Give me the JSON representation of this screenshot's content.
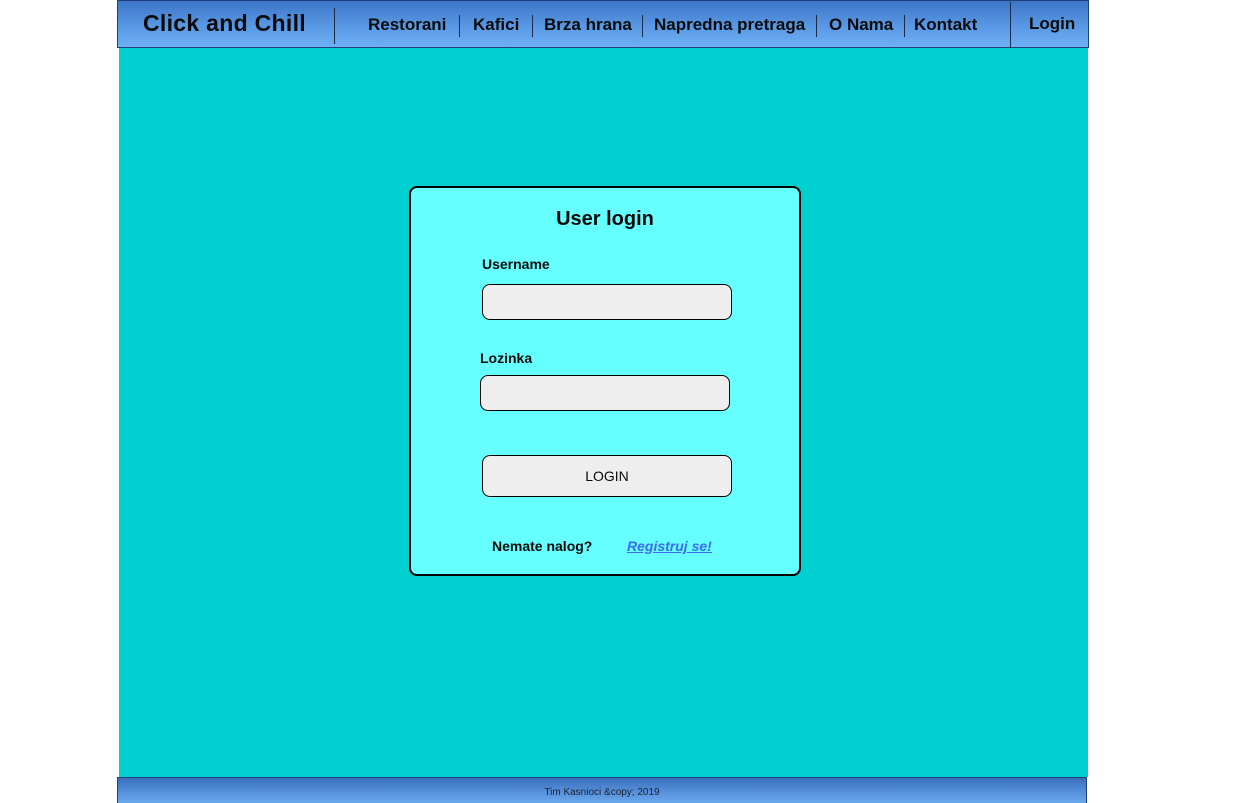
{
  "header": {
    "brand": "Click and Chill",
    "nav": [
      {
        "label": "Restorani"
      },
      {
        "label": "Kafici"
      },
      {
        "label": "Brza hrana"
      },
      {
        "label": "Napredna pretraga"
      },
      {
        "label": "O Nama"
      },
      {
        "label": "Kontakt"
      }
    ],
    "login_label": "Login"
  },
  "login_form": {
    "title": "User login",
    "username_label": "Username",
    "username_value": "",
    "password_label": "Lozinka",
    "password_value": "",
    "submit_label": "LOGIN",
    "no_account_text": "Nemate nalog?",
    "register_link": "Registruj se!"
  },
  "footer": {
    "text": "Tim Kasnioci &copy; 2019"
  },
  "colors": {
    "header_gradient_top": "#3d76c8",
    "header_gradient_bottom": "#6eb0f5",
    "main_background": "#00cfd0",
    "card_background": "#66ffff",
    "field_background": "#eeeeee",
    "link_color": "#3d6cf0"
  }
}
